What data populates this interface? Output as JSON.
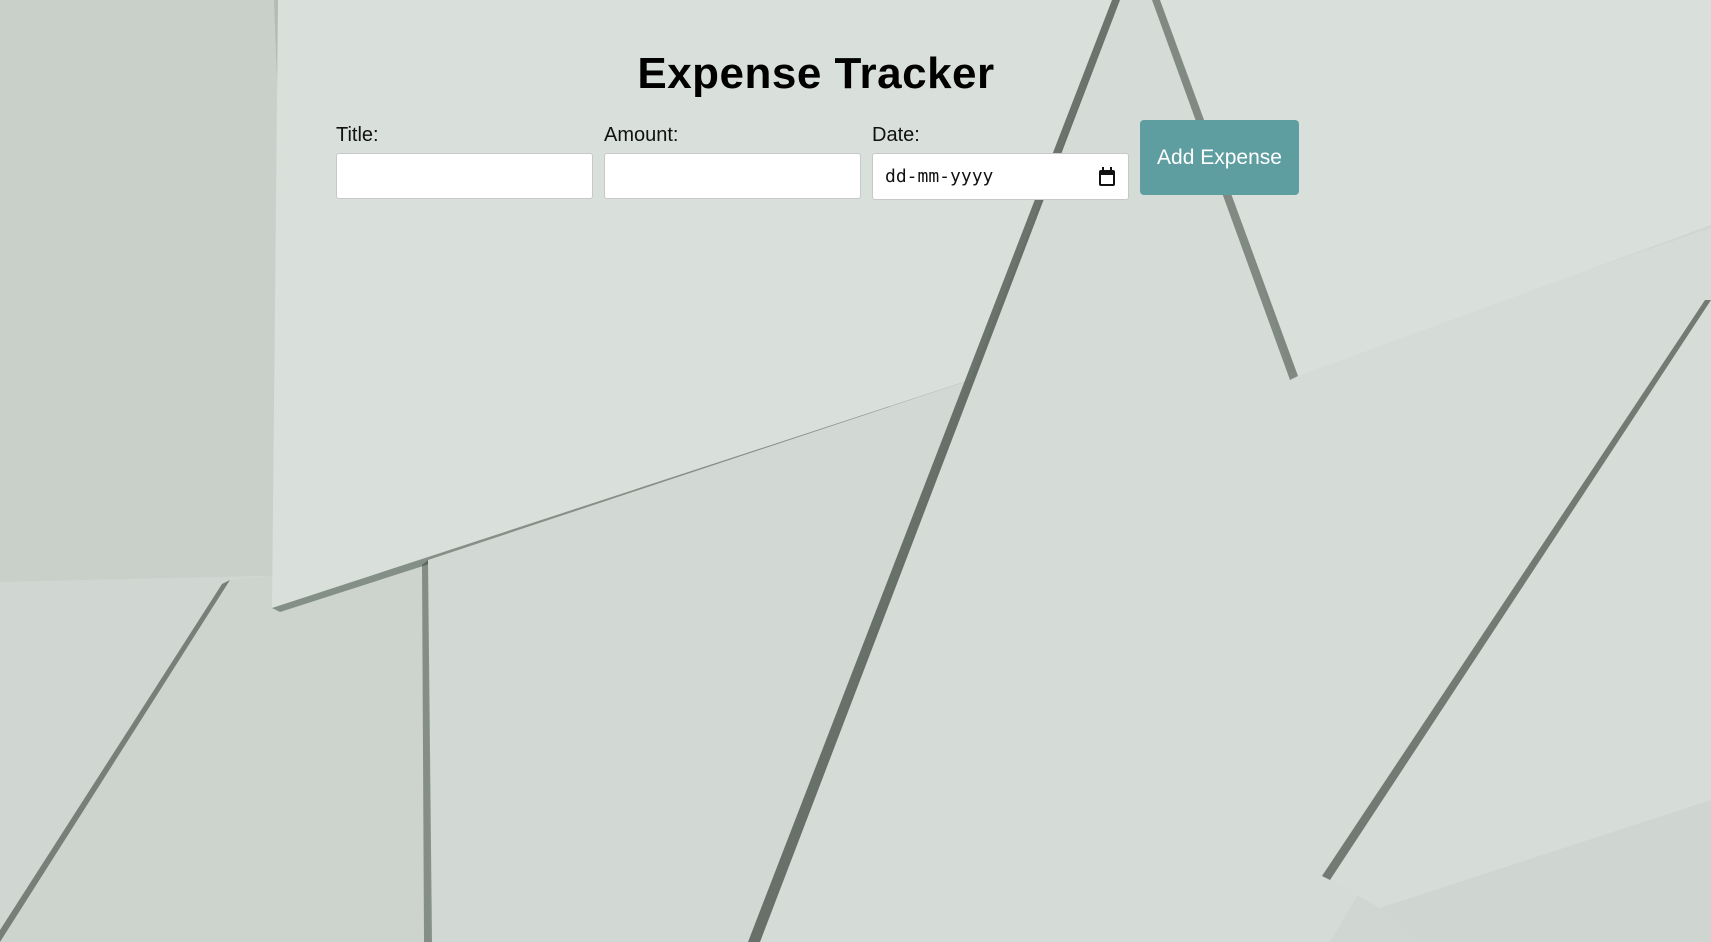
{
  "app": {
    "title": "Expense Tracker"
  },
  "form": {
    "title_label": "Title:",
    "title_value": "",
    "amount_label": "Amount:",
    "amount_value": "",
    "date_label": "Date:",
    "date_placeholder": "dd-mm-yyyy",
    "add_button_label": "Add Expense"
  },
  "colors": {
    "accent": "#5f9ea0",
    "background": "#d3d9d4"
  },
  "icons": {
    "date_picker": "calendar-icon"
  }
}
